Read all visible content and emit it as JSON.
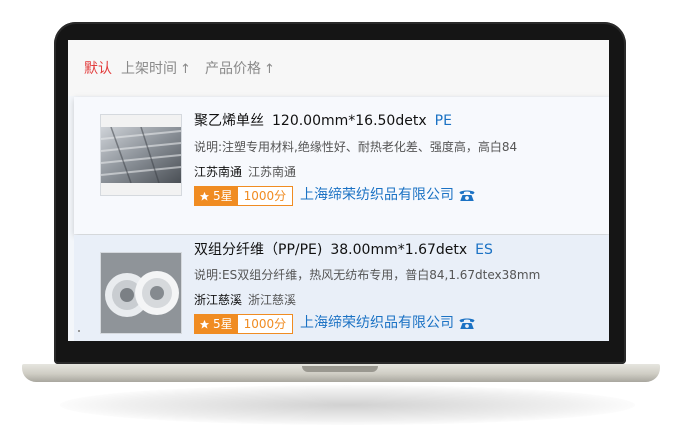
{
  "sort_bar": {
    "items": [
      {
        "label": "默认",
        "active": true,
        "arrow": ""
      },
      {
        "label": "上架时间",
        "active": false,
        "arrow": "↑"
      },
      {
        "label": "产品价格",
        "active": false,
        "arrow": "↑"
      }
    ]
  },
  "products": [
    {
      "name": "聚乙烯单丝",
      "spec": "120.00mm*16.50detx",
      "code": "PE",
      "description": "说明:注塑专用材料,绝缘性好、耐热老化差、强度高，高白84",
      "location_primary": "江苏南通",
      "location_secondary": "江苏南通",
      "rating_label": "5星",
      "score": "1000分",
      "company": "上海缔荣纺织品有限公司",
      "thumb_icon": "fiber-bale-image",
      "phone_icon": "phone-icon"
    },
    {
      "name": "双组分纤维（PP/PE)",
      "spec": "38.00mm*1.67detx",
      "code": "ES",
      "description": "说明:ES双组分纤维，热风无纺布专用，普白84,1.67dtex38mm",
      "location_primary": "浙江慈溪",
      "location_secondary": "浙江慈溪",
      "rating_label": "5星",
      "score": "1000分",
      "company": "上海缔荣纺织品有限公司",
      "thumb_icon": "fiber-rolls-image",
      "phone_icon": "phone-icon"
    }
  ],
  "colors": {
    "accent_blue": "#1b72c4",
    "active_red": "#e23b3b",
    "rating_orange": "#f08c22"
  }
}
